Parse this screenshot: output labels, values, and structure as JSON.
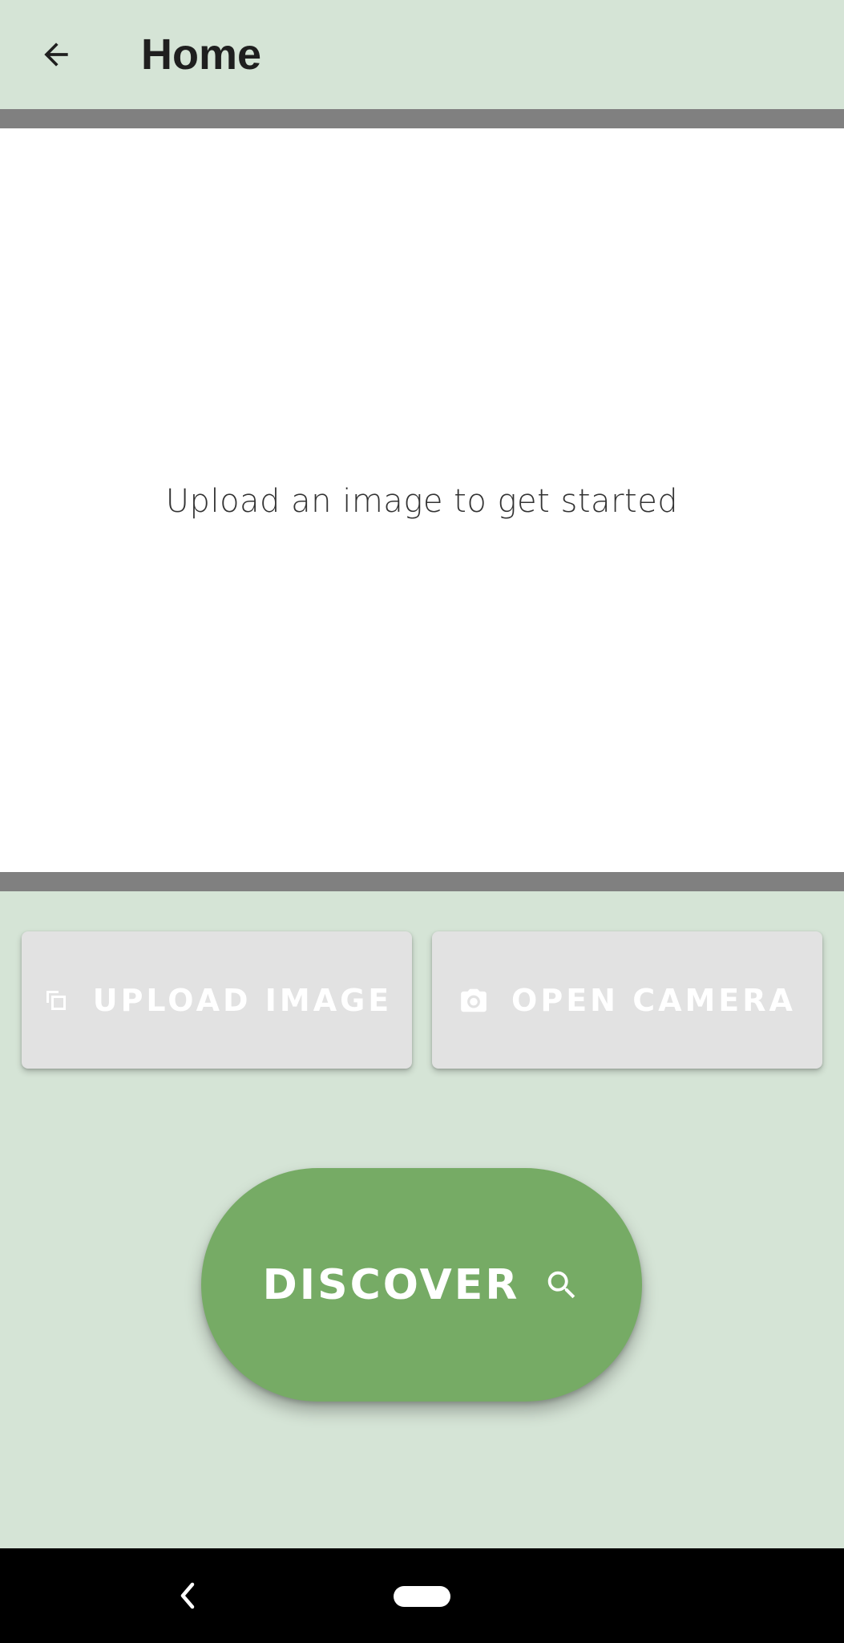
{
  "app_bar": {
    "title": "Home",
    "back_icon": "arrow-left-icon"
  },
  "image_area": {
    "placeholder": "Upload an image to get started"
  },
  "actions": {
    "upload": {
      "label": "UPLOAD IMAGE",
      "icon": "copy-images-icon"
    },
    "camera": {
      "label": "OPEN CAMERA",
      "icon": "camera-icon"
    }
  },
  "discover": {
    "label": "DISCOVER",
    "icon": "search-icon"
  },
  "system_nav": {
    "back_icon": "chevron-left-icon",
    "home_icon": "home-pill-icon"
  },
  "colors": {
    "background": "#d5e4d6",
    "divider": "#808080",
    "image_area": "#ffffff",
    "button": "#e2e2e2",
    "discover": "#76ab65",
    "nav_bar": "#000000"
  }
}
